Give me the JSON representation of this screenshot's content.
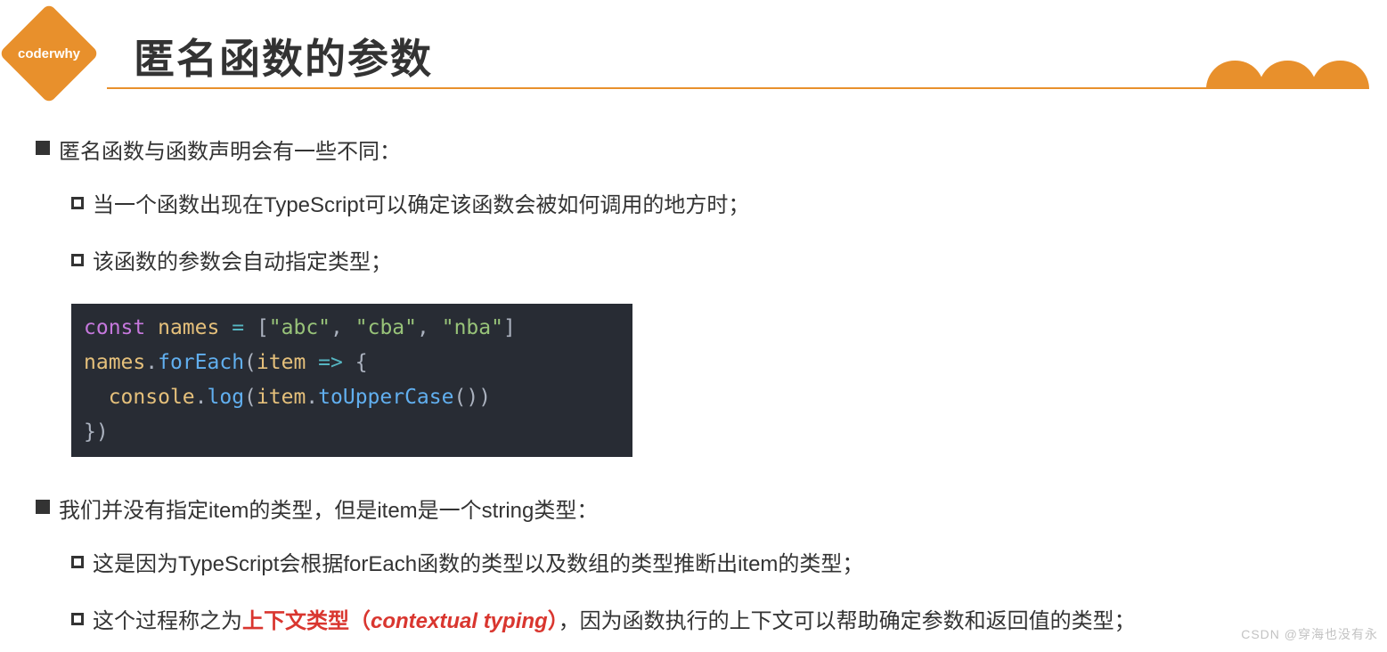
{
  "logo": {
    "text": "coderwhy"
  },
  "title": "匿名函数的参数",
  "section1": {
    "heading": "匿名函数与函数声明会有一些不同：",
    "sub1": "当一个函数出现在TypeScript可以确定该函数会被如何调用的地方时；",
    "sub2": "该函数的参数会自动指定类型；"
  },
  "code": {
    "line1": {
      "kw": "const",
      "name": "names",
      "eq": "=",
      "lb": "[",
      "s1": "\"abc\"",
      "c1": ",",
      "s2": "\"cba\"",
      "c2": ",",
      "s3": "\"nba\"",
      "rb": "]"
    },
    "line2": {
      "obj": "names",
      "dot": ".",
      "fn": "forEach",
      "lp": "(",
      "param": "item",
      "arrow": "=>",
      "lbrace": "{"
    },
    "line3": {
      "indent": "  ",
      "obj": "console",
      "dot": ".",
      "fn": "log",
      "lp": "(",
      "param": "item",
      "dot2": ".",
      "fn2": "toUpperCase",
      "lp2": "(",
      "rp2": ")",
      "rp": ")"
    },
    "line4": {
      "rbrace": "}",
      "rp": ")"
    }
  },
  "section2": {
    "heading": "我们并没有指定item的类型，但是item是一个string类型：",
    "sub1": "这是因为TypeScript会根据forEach函数的类型以及数组的类型推断出item的类型；",
    "sub2_pre": "这个过程称之为",
    "sub2_term_cn": "上下文类型（",
    "sub2_term_en": "contextual typing",
    "sub2_term_close": "）",
    "sub2_post": "，因为函数执行的上下文可以帮助确定参数和返回值的类型；"
  },
  "watermark": "CSDN @穿海也没有永"
}
